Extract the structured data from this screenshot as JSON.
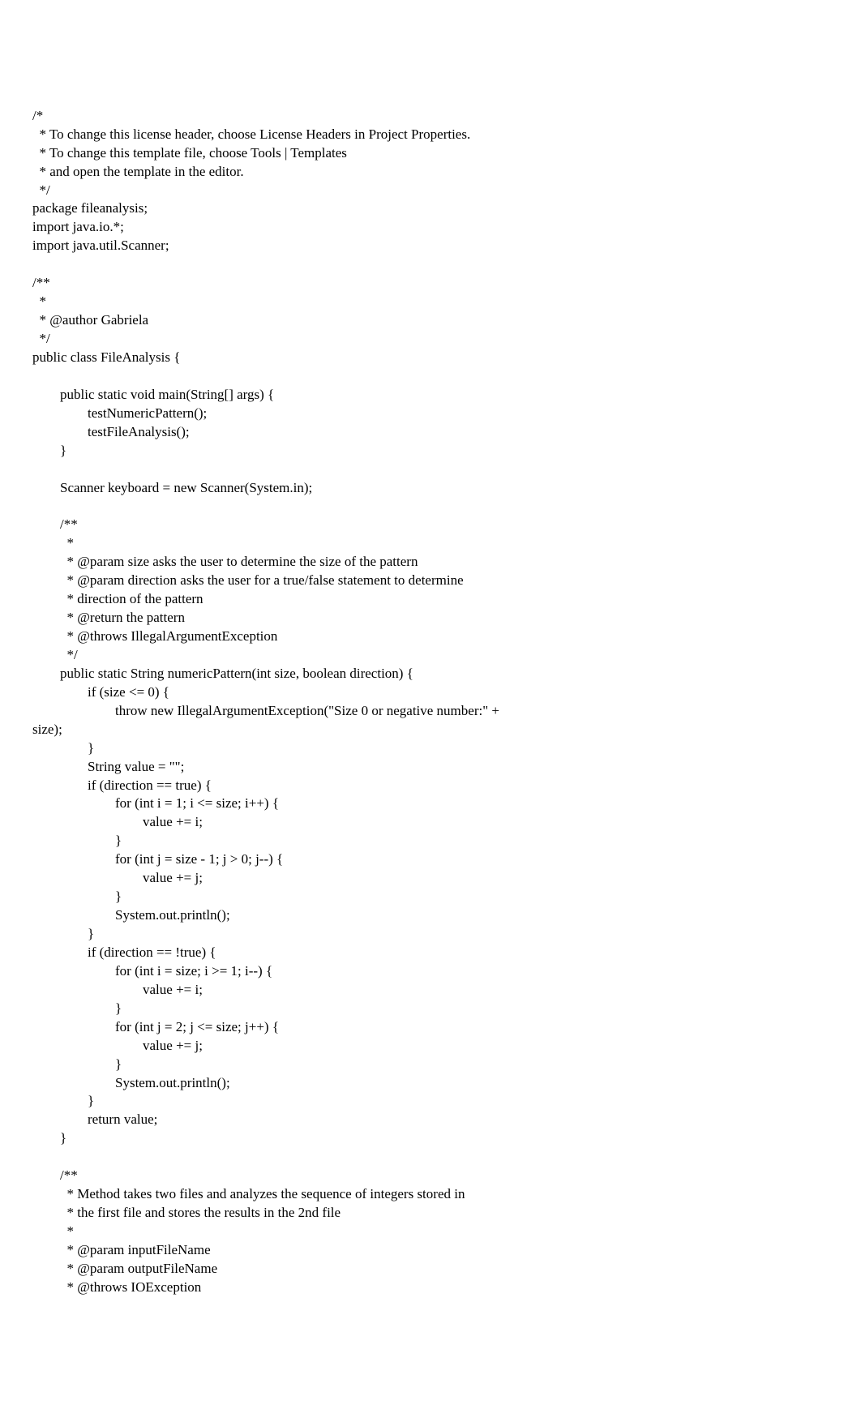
{
  "code": "/*\n  * To change this license header, choose License Headers in Project Properties.\n  * To change this template file, choose Tools | Templates\n  * and open the template in the editor.\n  */\npackage fileanalysis;\nimport java.io.*;\nimport java.util.Scanner;\n\n/**\n  *\n  * @author Gabriela\n  */\npublic class FileAnalysis {\n\n        public static void main(String[] args) {\n                testNumericPattern();\n                testFileAnalysis();\n        }\n\n        Scanner keyboard = new Scanner(System.in);\n\n        /**\n          *\n          * @param size asks the user to determine the size of the pattern\n          * @param direction asks the user for a true/false statement to determine\n          * direction of the pattern\n          * @return the pattern\n          * @throws IllegalArgumentException\n          */\n        public static String numericPattern(int size, boolean direction) {\n                if (size <= 0) {\n                        throw new IllegalArgumentException(\"Size 0 or negative number:\" +\nsize);\n                }\n                String value = \"\";\n                if (direction == true) {\n                        for (int i = 1; i <= size; i++) {\n                                value += i;\n                        }\n                        for (int j = size - 1; j > 0; j--) {\n                                value += j;\n                        }\n                        System.out.println();\n                }\n                if (direction == !true) {\n                        for (int i = size; i >= 1; i--) {\n                                value += i;\n                        }\n                        for (int j = 2; j <= size; j++) {\n                                value += j;\n                        }\n                        System.out.println();\n                }\n                return value;\n        }\n\n        /**\n          * Method takes two files and analyzes the sequence of integers stored in\n          * the first file and stores the results in the 2nd file\n          *\n          * @param inputFileName\n          * @param outputFileName\n          * @throws IOException"
}
